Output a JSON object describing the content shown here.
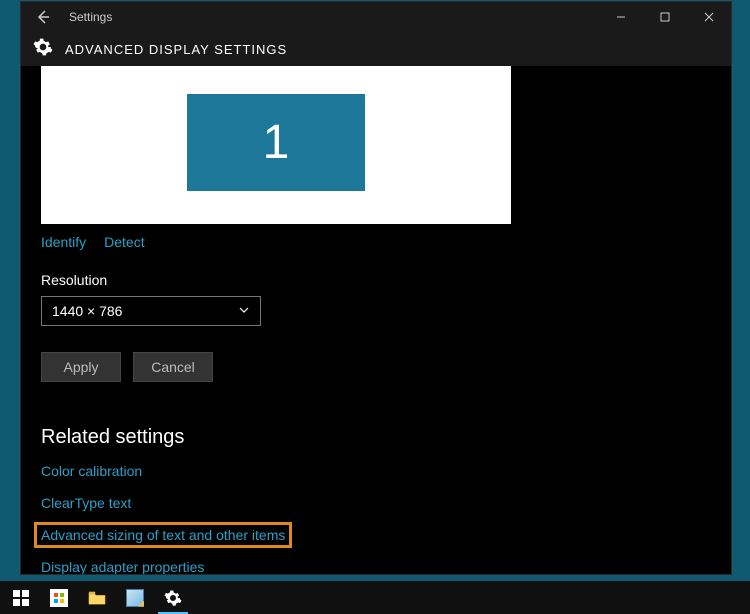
{
  "window": {
    "title": "Settings",
    "page_title": "ADVANCED DISPLAY SETTINGS"
  },
  "preview": {
    "monitor_number": "1",
    "identify": "Identify",
    "detect": "Detect"
  },
  "resolution": {
    "label": "Resolution",
    "value": "1440 × 786"
  },
  "buttons": {
    "apply": "Apply",
    "cancel": "Cancel"
  },
  "related": {
    "heading": "Related settings",
    "links": [
      "Color calibration",
      "ClearType text",
      "Advanced sizing of text and other items",
      "Display adapter properties"
    ]
  }
}
